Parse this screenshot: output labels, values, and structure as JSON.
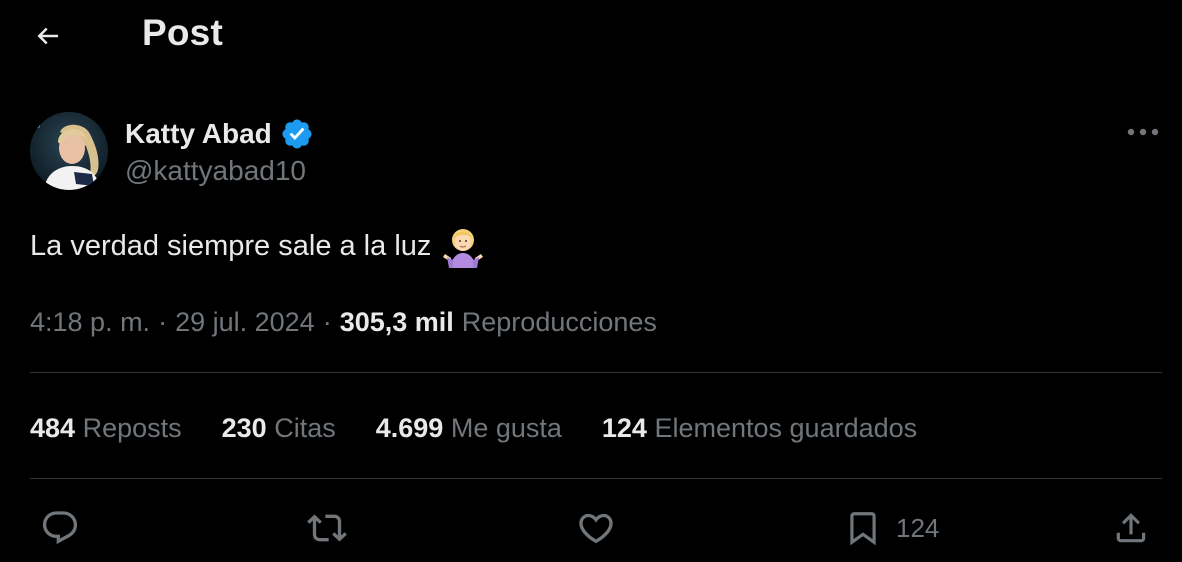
{
  "header": {
    "title": "Post",
    "back_icon": "arrow-left-icon"
  },
  "author": {
    "name": "Katty Abad",
    "handle": "@kattyabad10",
    "verified_color": "#1d9bf0"
  },
  "post": {
    "text": "La verdad siempre sale a la luz",
    "emoji": "person-shrugging-emoji"
  },
  "meta": {
    "time": "4:18 p. m.",
    "sep1": "·",
    "date": "29 jul. 2024",
    "sep2": "·",
    "views_count": "305,3 mil",
    "views_label": "Reproducciones"
  },
  "stats": [
    {
      "num": "484",
      "label": "Reposts"
    },
    {
      "num": "230",
      "label": "Citas"
    },
    {
      "num": "4.699",
      "label": "Me gusta"
    },
    {
      "num": "124",
      "label": "Elementos guardados"
    }
  ],
  "actions": {
    "reply_icon": "comment-icon",
    "repost_icon": "repost-icon",
    "like_icon": "heart-icon",
    "bookmark_icon": "bookmark-icon",
    "bookmark_count": "124",
    "share_icon": "share-icon"
  },
  "colors": {
    "background": "#000000",
    "text_primary": "#e7e9ea",
    "text_secondary": "#71767b",
    "divider": "#2f3336",
    "accent": "#1d9bf0"
  }
}
